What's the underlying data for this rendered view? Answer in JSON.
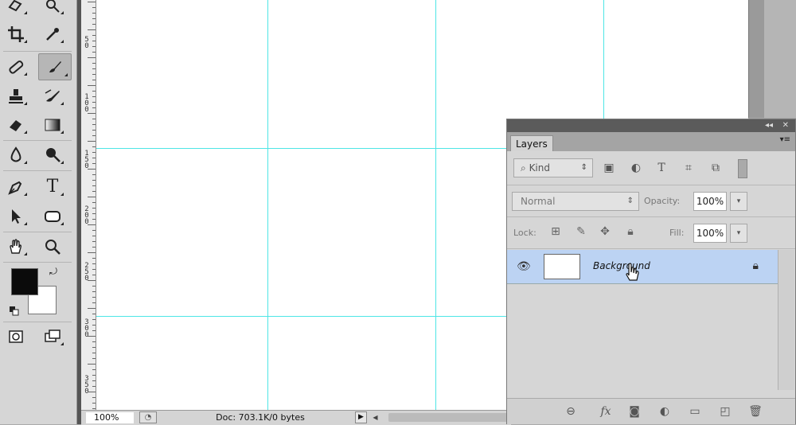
{
  "app": {
    "zoom": "100%",
    "doc_info": "Doc: 703.1K/0 bytes"
  },
  "tools": {
    "items": [
      {
        "name": "lasso-tool-icon"
      },
      {
        "name": "quick-selection-tool-icon"
      },
      {
        "name": "crop-tool-icon"
      },
      {
        "name": "eyedropper-tool-icon"
      },
      {
        "name": "spot-healing-tool-icon"
      },
      {
        "name": "brush-tool-icon",
        "active": true
      },
      {
        "name": "clone-stamp-tool-icon"
      },
      {
        "name": "history-brush-tool-icon"
      },
      {
        "name": "eraser-tool-icon"
      },
      {
        "name": "gradient-tool-icon"
      },
      {
        "name": "blur-tool-icon"
      },
      {
        "name": "dodge-tool-icon"
      },
      {
        "name": "pen-tool-icon"
      },
      {
        "name": "type-tool-icon",
        "glyph": "T"
      },
      {
        "name": "path-selection-tool-icon"
      },
      {
        "name": "shape-tool-icon"
      },
      {
        "name": "hand-tool-icon"
      },
      {
        "name": "zoom-tool-icon"
      }
    ],
    "foreground_color": "#0b0b0b",
    "background_color": "#ffffff"
  },
  "ruler": {
    "labels": [
      "5\n0",
      "1\n0\n0",
      "1\n5\n0",
      "2\n0\n0",
      "2\n5\n0",
      "3\n0\n0",
      "3\n5\n0"
    ]
  },
  "guides": {
    "color": "#4ee6e6"
  },
  "layers_panel": {
    "tab_label": "Layers",
    "filter_label": "Kind",
    "blend_mode": "Normal",
    "opacity_label": "Opacity:",
    "opacity_value": "100%",
    "lock_label": "Lock:",
    "fill_label": "Fill:",
    "fill_value": "100%",
    "layers": [
      {
        "name": "Background",
        "locked": true,
        "visible": true,
        "selected": true
      }
    ],
    "selected_color": "#bcd3f3"
  }
}
